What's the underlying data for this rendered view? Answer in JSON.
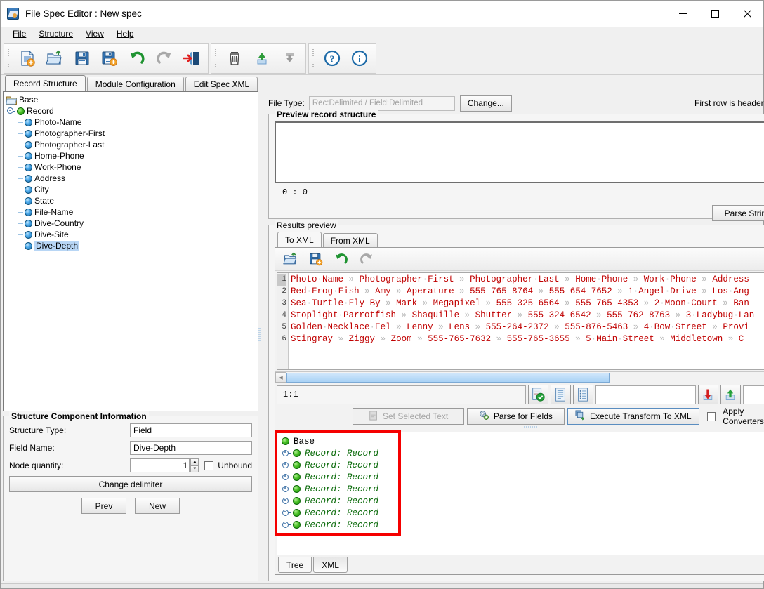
{
  "window": {
    "title": "File Spec Editor : New spec",
    "app_icon": "app-icon",
    "minimize": "—",
    "maximize": "▢",
    "close": "✕"
  },
  "menubar": [
    {
      "label": "File",
      "mnemonic": "F"
    },
    {
      "label": "Structure",
      "mnemonic": "S"
    },
    {
      "label": "View",
      "mnemonic": "V"
    },
    {
      "label": "Help",
      "mnemonic": "H"
    }
  ],
  "toolbar": {
    "groups": [
      {
        "buttons": [
          {
            "name": "new-spec-icon",
            "tip": "New"
          },
          {
            "name": "open-spec-icon",
            "tip": "Open"
          },
          {
            "name": "save-icon",
            "tip": "Save"
          },
          {
            "name": "save-as-icon",
            "tip": "Save As"
          },
          {
            "name": "undo-icon",
            "tip": "Undo"
          },
          {
            "name": "redo-icon",
            "tip": "Redo"
          },
          {
            "name": "exit-icon",
            "tip": "Exit"
          }
        ]
      },
      {
        "buttons": [
          {
            "name": "delete-icon",
            "tip": "Delete"
          },
          {
            "name": "move-up-icon",
            "tip": "Move Up"
          },
          {
            "name": "move-down-icon",
            "tip": "Move Down"
          }
        ]
      },
      {
        "buttons": [
          {
            "name": "help-icon",
            "tip": "Help"
          },
          {
            "name": "info-icon",
            "tip": "About"
          }
        ]
      }
    ]
  },
  "main_tabs": [
    {
      "label": "Record Structure",
      "active": true
    },
    {
      "label": "Module Configuration",
      "active": false
    },
    {
      "label": "Edit Spec XML",
      "active": false
    }
  ],
  "structure_tree": {
    "root": {
      "label": "Base",
      "icon": "folder-icon"
    },
    "record": {
      "label": "Record",
      "icon": "green-node-icon"
    },
    "fields": [
      {
        "label": "Photo-Name",
        "selected": false
      },
      {
        "label": "Photographer-First",
        "selected": false
      },
      {
        "label": "Photographer-Last",
        "selected": false
      },
      {
        "label": "Home-Phone",
        "selected": false
      },
      {
        "label": "Work-Phone",
        "selected": false
      },
      {
        "label": "Address",
        "selected": false
      },
      {
        "label": "City",
        "selected": false
      },
      {
        "label": "State",
        "selected": false
      },
      {
        "label": "File-Name",
        "selected": false
      },
      {
        "label": "Dive-Country",
        "selected": false
      },
      {
        "label": "Dive-Site",
        "selected": false
      },
      {
        "label": "Dive-Depth",
        "selected": true
      }
    ]
  },
  "component_info": {
    "legend": "Structure Component Information",
    "structure_type_label": "Structure Type:",
    "structure_type_value": "Field",
    "field_name_label": "Field Name:",
    "field_name_value": "Dive-Depth",
    "node_quantity_label": "Node quantity:",
    "node_quantity_value": "1",
    "unbound_label": "Unbound",
    "unbound_checked": false,
    "change_delimiter_label": "Change delimiter",
    "prev_label": "Prev",
    "new_label": "New"
  },
  "file_type": {
    "label": "File Type:",
    "value": "Rec:Delimited / Field:Delimited",
    "change_label": "Change...",
    "first_row_headers_label": "First row is headers",
    "first_row_headers_checked": false
  },
  "preview": {
    "legend": "Preview record structure",
    "text": "",
    "status": "0 : 0",
    "parse_string_label": "Parse String"
  },
  "results": {
    "legend": "Results preview",
    "tabs": [
      {
        "label": "To XML",
        "active": true
      },
      {
        "label": "From XML",
        "active": false
      }
    ],
    "toolbar": [
      {
        "name": "open-file-icon"
      },
      {
        "name": "save-file-icon"
      },
      {
        "name": "undo-icon"
      },
      {
        "name": "redo-icon"
      }
    ],
    "editor": {
      "gutter": [
        "1",
        "2",
        "3",
        "4",
        "5",
        "6"
      ],
      "lines": [
        [
          "Photo Name",
          "Photographer First",
          "Photographer Last",
          "Home Phone",
          "Work Phone",
          "Address"
        ],
        [
          "Red Frog Fish",
          "Amy",
          "Aperature",
          "555-765-8764",
          "555-654-7652",
          "1 Angel Drive",
          "Los Ang"
        ],
        [
          "Sea Turtle Fly-By",
          "Mark",
          "Megapixel",
          "555-325-6564",
          "555-765-4353",
          "2 Moon Court",
          "Ban"
        ],
        [
          "Stoplight Parrotfish",
          "Shaquille",
          "Shutter",
          "555-324-6542",
          "555-762-8763",
          "3 Ladybug Lan"
        ],
        [
          "Golden Necklace Eel",
          "Lenny",
          "Lens",
          "555-264-2372",
          "555-876-5463",
          "4 Bow Street",
          "Provi"
        ],
        [
          "Stingray",
          "Ziggy",
          "Zoom",
          "555-765-7632",
          "555-765-3655",
          "5 Main Street",
          "Middletown",
          "C"
        ]
      ],
      "separator": "»"
    },
    "caret_position": "1:1",
    "status_buttons": [
      {
        "name": "validate-document-icon"
      },
      {
        "name": "document-lines-icon"
      },
      {
        "name": "document-list-icon"
      }
    ],
    "encoding_field": "",
    "import-export_buttons": [
      {
        "name": "download-red-icon"
      },
      {
        "name": "upload-green-icon"
      }
    ],
    "trailing_field": "",
    "actions": {
      "set_selected_text": "Set Selected Text",
      "set_selected_text_enabled": false,
      "parse_for_fields": "Parse for Fields",
      "execute_transform": "Execute Transform To XML",
      "apply_converters": "Apply Converters",
      "apply_converters_checked": false
    },
    "output_tree": {
      "root": "Base",
      "nodes": [
        "Record: Record",
        "Record: Record",
        "Record: Record",
        "Record: Record",
        "Record: Record",
        "Record: Record",
        "Record: Record"
      ],
      "highlight_color": "#f50000"
    },
    "bottom_tabs": [
      {
        "label": "Tree",
        "active": true
      },
      {
        "label": "XML",
        "active": false
      }
    ]
  },
  "colors": {
    "accent_blue": "#2f6fae",
    "code_red": "#c00000",
    "tree_green": "#0b6b0b",
    "selection_blue": "#b8d6f5",
    "highlight_red": "#f50000"
  }
}
